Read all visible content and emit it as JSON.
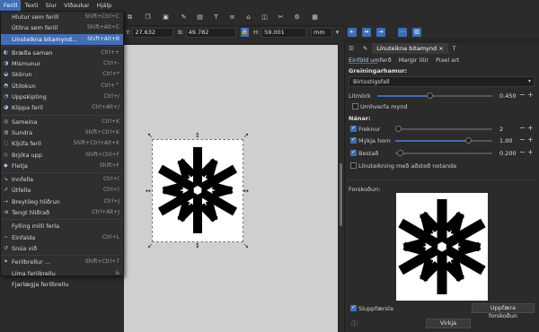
{
  "menubar": {
    "items": [
      "Ferill",
      "Texti",
      "Síur",
      "Viðaukar",
      "Hjálp"
    ]
  },
  "toolbar": {
    "x_label": "Y:",
    "x_value": "27.632",
    "y_label": "B:",
    "y_value": "49.782",
    "h_label": "H:",
    "h_value": "59.001",
    "unit": "mm"
  },
  "menu": {
    "items": [
      {
        "label": "Hlutur sem ferill",
        "shortcut": "Shift+Ctrl+C",
        "icon": ""
      },
      {
        "label": "Útlína sem ferill",
        "shortcut": "Shift+Alt+C",
        "icon": ""
      },
      {
        "label": "Línuteikna bitamynd...",
        "shortcut": "Shift+Alt+B",
        "icon": ""
      },
      {
        "label": "Bræða saman",
        "shortcut": "Ctrl++",
        "icon": "◐"
      },
      {
        "label": "Mismunur",
        "shortcut": "Ctrl+-",
        "icon": "◑"
      },
      {
        "label": "Skörun",
        "shortcut": "Ctrl+*",
        "icon": "◒"
      },
      {
        "label": "Útilokun",
        "shortcut": "Ctrl+^",
        "icon": "◓"
      },
      {
        "label": "Uppskipting",
        "shortcut": "Ctrl+/",
        "icon": "◔"
      },
      {
        "label": "Klippa feril",
        "shortcut": "Ctrl+Alt+/",
        "icon": "◕"
      },
      {
        "label": "Sameina",
        "shortcut": "Ctrl+K",
        "icon": "◎"
      },
      {
        "label": "Sundra",
        "shortcut": "Shift+Ctrl+K",
        "icon": "◍"
      },
      {
        "label": "Kljúfa feril",
        "shortcut": "Shift+Ctrl+Alt+K",
        "icon": "◌"
      },
      {
        "label": "Brjóta upp",
        "shortcut": "Shift+Ctrl+F",
        "icon": "◇"
      },
      {
        "label": "Fletja",
        "shortcut": "Shift+F",
        "icon": "◆"
      },
      {
        "label": "Innfella",
        "shortcut": "Ctrl+(",
        "icon": "↘"
      },
      {
        "label": "Útfella",
        "shortcut": "Ctrl+)",
        "icon": "↗"
      },
      {
        "label": "Breytileg hliðrun",
        "shortcut": "Ctrl+J",
        "icon": "⇢"
      },
      {
        "label": "Tengt hliðrað",
        "shortcut": "Ctrl+Alt+J",
        "icon": "⇉"
      },
      {
        "label": "Fylling milli ferla",
        "shortcut": "",
        "icon": ""
      },
      {
        "label": "Einfalda",
        "shortcut": "Ctrl+L",
        "icon": "~"
      },
      {
        "label": "Snúa við",
        "shortcut": "",
        "icon": "↺"
      },
      {
        "label": "Ferilbrellur ...",
        "shortcut": "Shift+Ctrl+7",
        "icon": "✦"
      },
      {
        "label": "Líma ferilbrellu",
        "shortcut": "&",
        "icon": ""
      },
      {
        "label": "Fjarlægja ferilbrellu",
        "shortcut": "",
        "icon": ""
      }
    ],
    "highlighted_index": 2
  },
  "panel": {
    "tab_active": "Línuteikna bitamynd",
    "subtabs": [
      "Einföld umferð",
      "Margir litir",
      "Pixel art"
    ],
    "detection_label": "Greiningarhamur:",
    "detection_value": "Birtustigsfall",
    "threshold_label": "Litmörk",
    "threshold_value": "0.450",
    "invert_label": "Umhverfa mynd",
    "options_label": "Nánar:",
    "speckles_label": "Freknur",
    "speckles_value": "2",
    "smooth_label": "Mýkja horn",
    "smooth_value": "1.00",
    "optimize_label": "Bestað",
    "optimize_value": "0.200",
    "stack_label": "Línuteikning með aðstoð notanda",
    "preview_label": "Forskoðun:",
    "live_label": "Sluppfærsla",
    "update_button": "Uppfæra forskoðun",
    "apply_button": "Virkja"
  },
  "levels": {
    "threshold": 0.45,
    "speckles": 0.03,
    "smooth": 0.75,
    "optimize": 0.05
  }
}
